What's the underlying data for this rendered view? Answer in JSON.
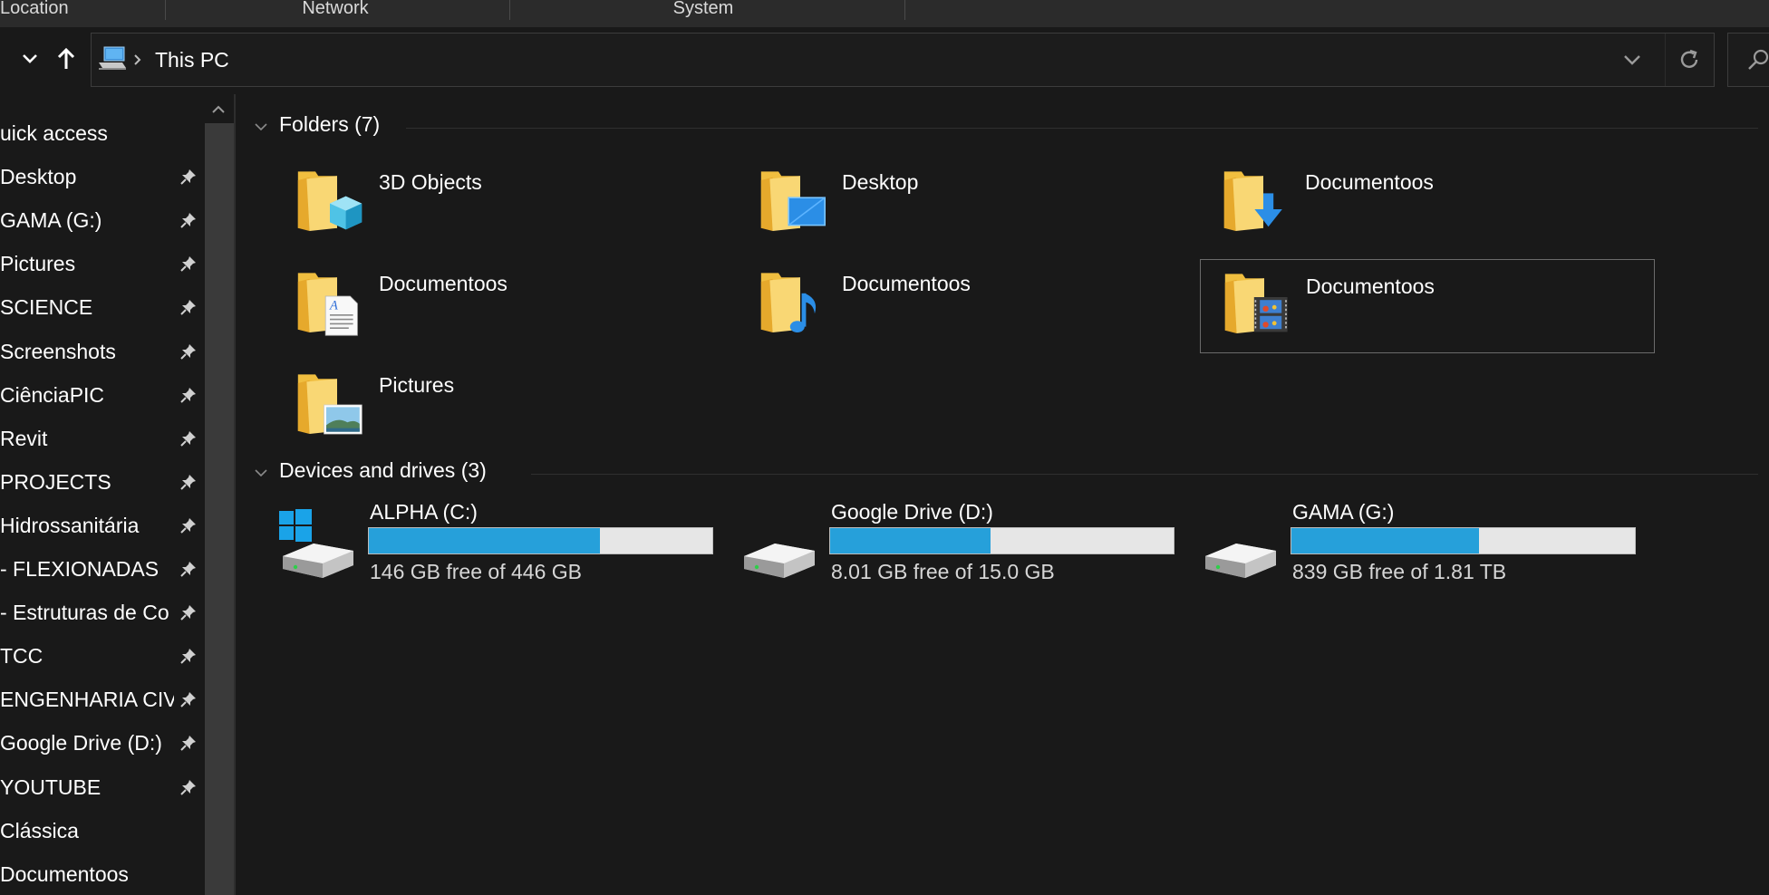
{
  "ribbon": {
    "groups": [
      "Location",
      "Network",
      "System"
    ]
  },
  "address": {
    "breadcrumb": "This PC"
  },
  "sidebar": {
    "items": [
      {
        "label": "uick access",
        "pinned": false
      },
      {
        "label": "Desktop",
        "pinned": true
      },
      {
        "label": "GAMA (G:)",
        "pinned": true
      },
      {
        "label": "Pictures",
        "pinned": true
      },
      {
        "label": "SCIENCE",
        "pinned": true
      },
      {
        "label": "Screenshots",
        "pinned": true
      },
      {
        "label": "CiênciaPIC",
        "pinned": true
      },
      {
        "label": "Revit",
        "pinned": true
      },
      {
        "label": "PROJECTS",
        "pinned": true
      },
      {
        "label": "Hidrossanitária",
        "pinned": true
      },
      {
        "label": "- FLEXIONADAS",
        "pinned": true
      },
      {
        "label": "- Estruturas de Co",
        "pinned": true
      },
      {
        "label": "TCC",
        "pinned": true
      },
      {
        "label": "ENGENHARIA CIVIL",
        "pinned": true
      },
      {
        "label": "Google Drive (D:)",
        "pinned": true
      },
      {
        "label": "YOUTUBE",
        "pinned": true
      },
      {
        "label": "Clássica",
        "pinned": false
      },
      {
        "label": "Documentoos",
        "pinned": false
      }
    ]
  },
  "folders_group": {
    "title": "Folders (7)",
    "items": [
      {
        "label": "3D Objects",
        "icon": "3d-objects-folder-icon"
      },
      {
        "label": "Desktop",
        "icon": "desktop-folder-icon"
      },
      {
        "label": "Documentoos",
        "icon": "downloads-folder-icon"
      },
      {
        "label": "Documentoos",
        "icon": "documents-folder-icon"
      },
      {
        "label": "Documentoos",
        "icon": "music-folder-icon"
      },
      {
        "label": "Documentoos",
        "icon": "videos-folder-icon",
        "selected": true
      },
      {
        "label": "Pictures",
        "icon": "pictures-folder-icon"
      }
    ]
  },
  "drives_group": {
    "title": "Devices and drives (3)",
    "items": [
      {
        "name": "ALPHA (C:)",
        "free_text": "146 GB free of 446 GB",
        "used_fraction": 0.673,
        "icon": "windows-drive-icon"
      },
      {
        "name": "Google Drive (D:)",
        "free_text": "8.01 GB free of 15.0 GB",
        "used_fraction": 0.466,
        "icon": "hard-drive-icon"
      },
      {
        "name": "GAMA (G:)",
        "free_text": "839 GB free of 1.81 TB",
        "used_fraction": 0.547,
        "icon": "hard-drive-icon"
      }
    ]
  },
  "colors": {
    "background": "#191919",
    "drive_fill": "#26a0da",
    "folder_yellow": "#f5c94a"
  }
}
